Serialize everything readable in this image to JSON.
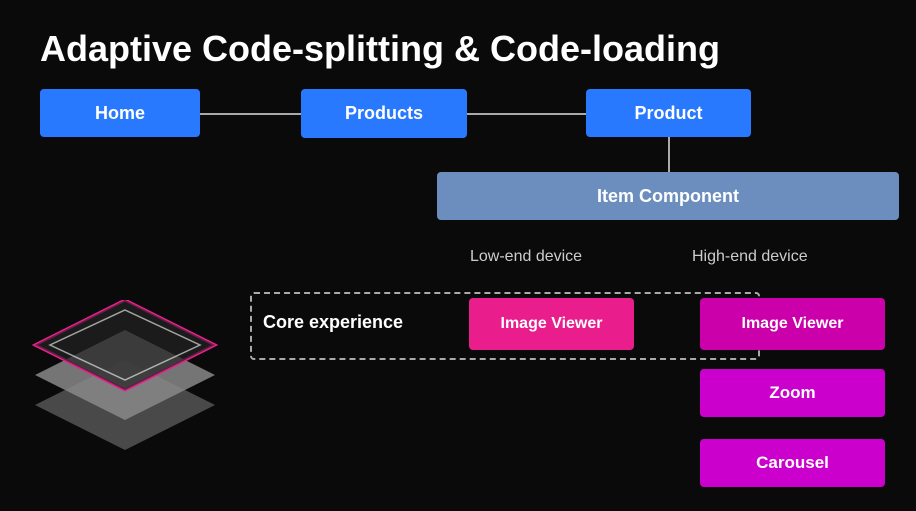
{
  "title": "Adaptive Code-splitting & Code-loading",
  "routes": {
    "home": "Home",
    "products": "Products",
    "product": "Product"
  },
  "item_component": "Item Component",
  "labels": {
    "lowend": "Low-end device",
    "highend": "High-end device",
    "core_experience": "Core experience"
  },
  "boxes": {
    "image_viewer": "Image Viewer",
    "zoom": "Zoom",
    "carousel": "Carousel"
  }
}
